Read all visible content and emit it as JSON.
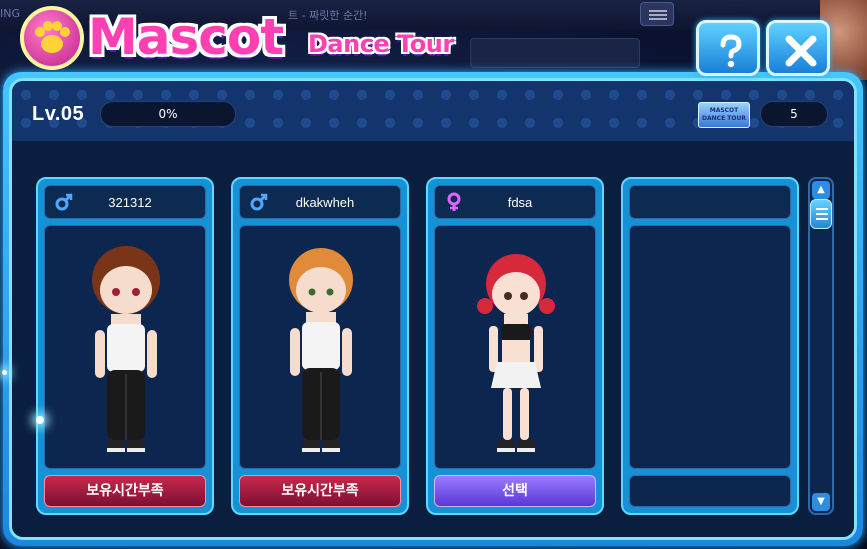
{
  "background": {
    "top_text_left": "ING",
    "top_text_mid": "트 - 짜릿한 순간!"
  },
  "header": {
    "title": "Mascot",
    "subtitle": "Dance Tour",
    "help_icon": "question-icon",
    "close_icon": "close-icon"
  },
  "status": {
    "level": "Lv.05",
    "progress": 0,
    "progress_text": "0%",
    "ticket_label": "MASCOT DANCE TOUR",
    "ticket_count": "5"
  },
  "cards": [
    {
      "name": "321312",
      "gender": "male",
      "button": "보유시간부족",
      "button_style": "red"
    },
    {
      "name": "dkakwheh",
      "gender": "male",
      "button": "보유시간부족",
      "button_style": "red"
    },
    {
      "name": "fdsa",
      "gender": "female",
      "button": "선택",
      "button_style": "purple"
    },
    {
      "name": "",
      "gender": "",
      "button": "",
      "button_style": "empty"
    }
  ],
  "colors": {
    "accent": "#45c6ff",
    "title_pink": "#ff3fb2",
    "male": "#4fa8ff",
    "female": "#e064ff",
    "button_red": "#a81c40",
    "button_purple": "#7a58f0"
  },
  "icons": {
    "paw": "paw-icon",
    "male": "male-icon",
    "female": "female-icon",
    "scroll_up": "arrow-up-icon",
    "scroll_down": "arrow-down-icon"
  }
}
